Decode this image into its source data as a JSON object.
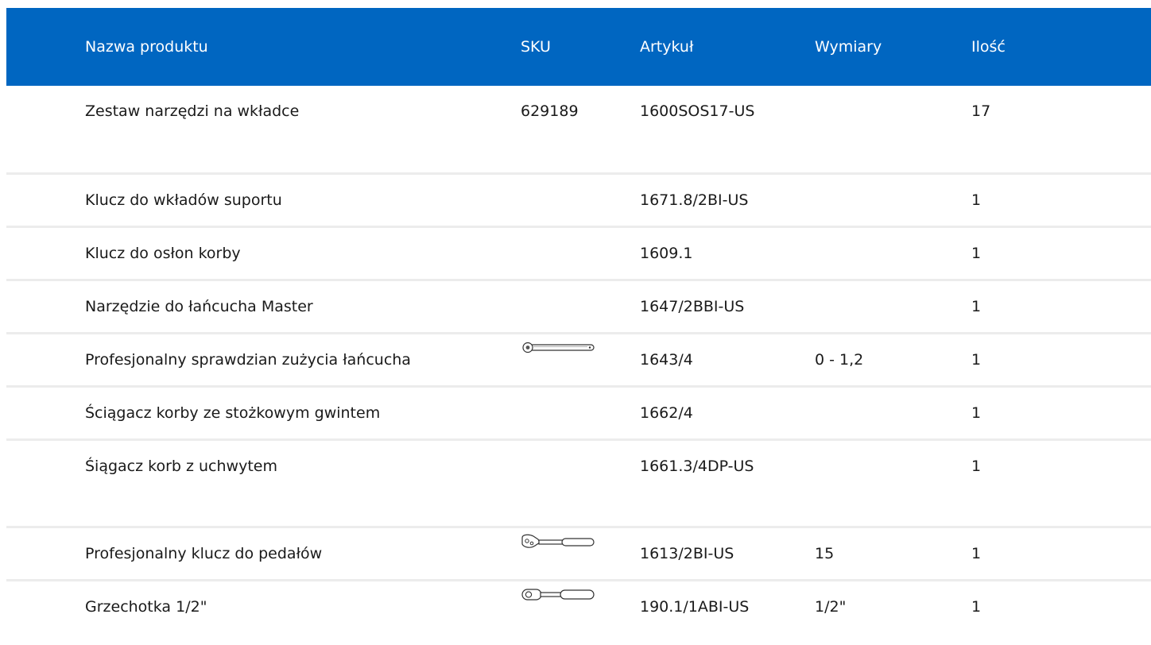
{
  "table": {
    "headers": {
      "name": "Nazwa produktu",
      "sku": "SKU",
      "article": "Artykuł",
      "dimensions": "Wymiary",
      "quantity": "Ilość"
    },
    "rows": [
      {
        "name": "Zestaw narzędzi na wkładce",
        "sku": "629189",
        "article": "1600SOS17-US",
        "dimensions": "",
        "quantity": "17"
      },
      {
        "name": "Klucz do wkładów suportu",
        "sku": "",
        "article": "1671.8/2BI-US",
        "dimensions": "",
        "quantity": "1"
      },
      {
        "name": "Klucz do osłon korby",
        "sku": "",
        "article": "1609.1",
        "dimensions": "",
        "quantity": "1"
      },
      {
        "name": "Narzędzie do łańcucha Master",
        "sku": "",
        "article": "1647/2BBI-US",
        "dimensions": "",
        "quantity": "1"
      },
      {
        "name": "Profesjonalny sprawdzian zużycia łańcucha",
        "sku_icon": "chain-wear-gauge-icon",
        "article": "1643/4",
        "dimensions": "0 - 1,2",
        "quantity": "1"
      },
      {
        "name": "Ściągacz korby ze stożkowym gwintem",
        "sku": "",
        "article": "1662/4",
        "dimensions": "",
        "quantity": "1"
      },
      {
        "name": "Śiągacz korb z uchwytem",
        "sku": "",
        "article": "1661.3/4DP-US",
        "dimensions": "",
        "quantity": "1"
      },
      {
        "name": "Profesjonalny klucz do pedałów",
        "sku_icon": "pedal-wrench-icon",
        "article": "1613/2BI-US",
        "dimensions": "15",
        "quantity": "1"
      },
      {
        "name": "Grzechotka 1/2\"",
        "sku_icon": "ratchet-icon",
        "article": "190.1/1ABI-US",
        "dimensions": "1/2\"",
        "quantity": "1"
      }
    ]
  },
  "colors": {
    "header_bg": "#0066c1",
    "header_text": "#ffffff",
    "row_divider": "#ececec"
  }
}
